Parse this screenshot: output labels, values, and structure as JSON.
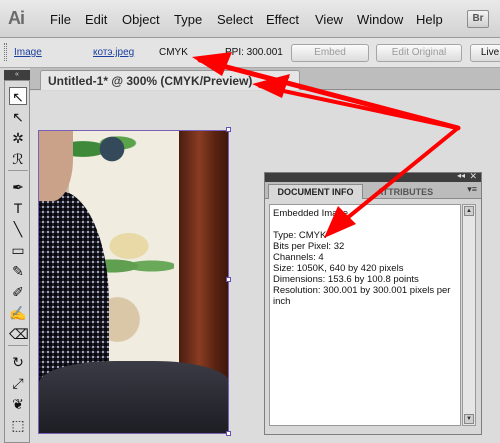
{
  "app": {
    "logo": "Ai",
    "bridge_button": "Br"
  },
  "menu": [
    "File",
    "Edit",
    "Object",
    "Type",
    "Select",
    "Effect",
    "View",
    "Window",
    "Help"
  ],
  "control_bar": {
    "object_type": "Image",
    "file_name": "котэ.jpeg",
    "color_mode": "CMYK",
    "ppi": "PPI: 300.001",
    "embed_button": "Embed",
    "edit_original_button": "Edit Original",
    "live_trace_button": "Live"
  },
  "document_tab": {
    "title": "Untitled-1* @ 300% (CMYK/Preview)",
    "close": "✕"
  },
  "toolbox": {
    "header": "«",
    "tools": [
      {
        "name": "selection-tool-icon",
        "glyph": "↖"
      },
      {
        "name": "direct-selection-tool-icon",
        "glyph": "↖"
      },
      {
        "name": "magic-wand-tool-icon",
        "glyph": "✲"
      },
      {
        "name": "lasso-tool-icon",
        "glyph": "ℛ"
      },
      {
        "name": "pen-tool-icon",
        "glyph": "✒"
      },
      {
        "name": "type-tool-icon",
        "glyph": "T"
      },
      {
        "name": "line-tool-icon",
        "glyph": "╲"
      },
      {
        "name": "rectangle-tool-icon",
        "glyph": "▭"
      },
      {
        "name": "paintbrush-tool-icon",
        "glyph": "✎"
      },
      {
        "name": "pencil-tool-icon",
        "glyph": "✐"
      },
      {
        "name": "blob-brush-tool-icon",
        "glyph": "✍"
      },
      {
        "name": "eraser-tool-icon",
        "glyph": "⌫"
      },
      {
        "name": "rotate-tool-icon",
        "glyph": "↻"
      },
      {
        "name": "scale-tool-icon",
        "glyph": "⤢"
      },
      {
        "name": "warp-tool-icon",
        "glyph": "❦"
      },
      {
        "name": "free-transform-tool-icon",
        "glyph": "⬚"
      }
    ]
  },
  "doc_info_panel": {
    "tab_active": "DOCUMENT INFO",
    "tab_inactive": "ATTRIBUTES",
    "collapse": "◂◂",
    "close": "✕",
    "menu": "▾≡",
    "lines": [
      "Embedded Image",
      "",
      "Type: CMYK",
      "Bits per Pixel: 32",
      "Channels: 4",
      "Size: 1050K, 640 by 420 pixels",
      "Dimensions: 153.6 by 100.8 points",
      "Resolution: 300.001 by 300.001 pixels per",
      "inch"
    ],
    "scroll_up": "▲",
    "scroll_down": "▼"
  },
  "annotation_color": "#ff0000"
}
